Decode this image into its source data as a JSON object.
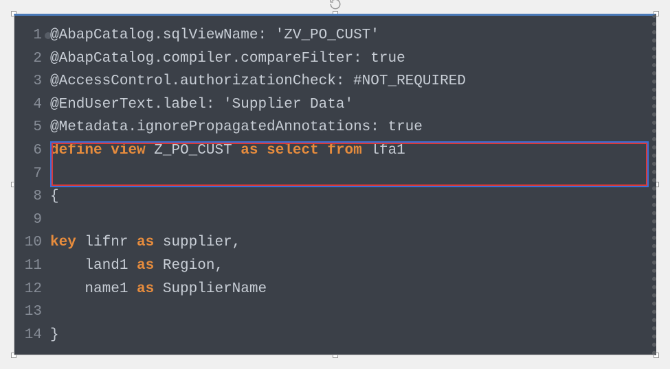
{
  "editor": {
    "lines": [
      {
        "num": "1",
        "foldable": true,
        "segments": [
          {
            "text": "@AbapCatalog.sqlViewName: 'ZV_PO_CUST'",
            "cls": "annotation-text"
          }
        ]
      },
      {
        "num": "2",
        "segments": [
          {
            "text": "@AbapCatalog.compiler.compareFilter: true",
            "cls": "annotation-text"
          }
        ]
      },
      {
        "num": "3",
        "segments": [
          {
            "text": "@AccessControl.authorizationCheck: #NOT_REQUIRED",
            "cls": "annotation-text"
          }
        ]
      },
      {
        "num": "4",
        "segments": [
          {
            "text": "@EndUserText.label: 'Supplier Data'",
            "cls": "annotation-text"
          }
        ]
      },
      {
        "num": "5",
        "segments": [
          {
            "text": "@Metadata.ignorePropagatedAnnotations: true",
            "cls": "annotation-text"
          }
        ]
      },
      {
        "num": "6",
        "highlighted": true,
        "segments": [
          {
            "text": "define",
            "cls": "keyword"
          },
          {
            "text": " ",
            "cls": "identifier"
          },
          {
            "text": "view",
            "cls": "keyword"
          },
          {
            "text": " Z_PO_CUST ",
            "cls": "identifier"
          },
          {
            "text": "as",
            "cls": "keyword"
          },
          {
            "text": " ",
            "cls": "identifier"
          },
          {
            "text": "select",
            "cls": "keyword"
          },
          {
            "text": " ",
            "cls": "identifier"
          },
          {
            "text": "from",
            "cls": "keyword"
          },
          {
            "text": " lfa1",
            "cls": "identifier"
          }
        ]
      },
      {
        "num": "7",
        "highlighted": true,
        "segments": []
      },
      {
        "num": "8",
        "segments": [
          {
            "text": "{",
            "cls": "brace"
          }
        ]
      },
      {
        "num": "9",
        "segments": []
      },
      {
        "num": "10",
        "segments": [
          {
            "text": "key",
            "cls": "keyword"
          },
          {
            "text": " lifnr ",
            "cls": "identifier"
          },
          {
            "text": "as",
            "cls": "keyword"
          },
          {
            "text": " supplier,",
            "cls": "identifier"
          }
        ]
      },
      {
        "num": "11",
        "segments": [
          {
            "text": "    land1 ",
            "cls": "identifier"
          },
          {
            "text": "as",
            "cls": "keyword"
          },
          {
            "text": " Region,",
            "cls": "identifier"
          }
        ]
      },
      {
        "num": "12",
        "segments": [
          {
            "text": "    name1 ",
            "cls": "identifier"
          },
          {
            "text": "as",
            "cls": "keyword"
          },
          {
            "text": " SupplierName",
            "cls": "identifier"
          }
        ]
      },
      {
        "num": "13",
        "segments": []
      },
      {
        "num": "14",
        "segments": [
          {
            "text": "}",
            "cls": "brace"
          }
        ]
      }
    ],
    "highlight_box": {
      "top_line": 6,
      "bottom_line": 7
    }
  }
}
